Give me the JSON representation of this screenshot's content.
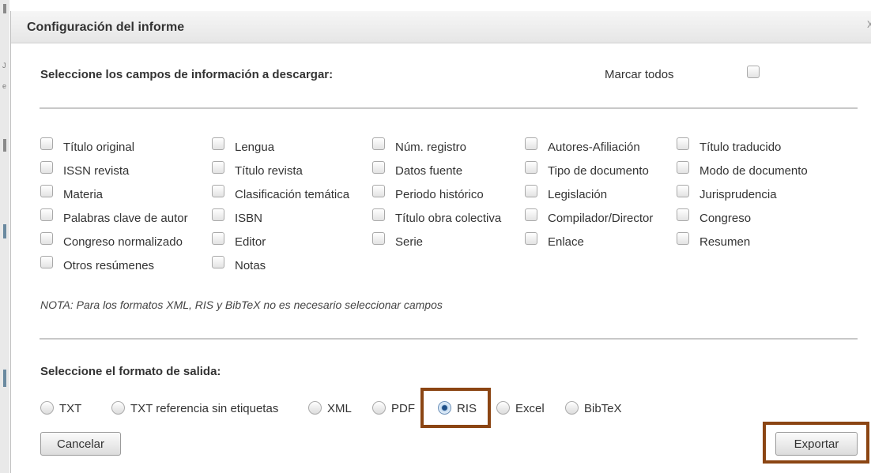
{
  "dialog": {
    "title": "Configuración del informe",
    "close_glyph": "x"
  },
  "fields_section": {
    "heading": "Seleccione los campos de información a descargar:",
    "mark_all_label": "Marcar todos",
    "columns": [
      [
        "Título original",
        "ISSN revista",
        "Materia",
        "Palabras clave de autor",
        "Congreso normalizado",
        "Otros resúmenes"
      ],
      [
        "Lengua",
        "Título revista",
        "Clasificación temática",
        "ISBN",
        "Editor",
        "Notas"
      ],
      [
        "Núm. registro",
        "Datos fuente",
        "Periodo histórico",
        "Título obra colectiva",
        "Serie"
      ],
      [
        "Autores-Afiliación",
        "Tipo de documento",
        "Legislación",
        "Compilador/Director",
        "Enlace"
      ],
      [
        "Título traducido",
        "Modo de documento",
        "Jurisprudencia",
        "Congreso",
        "Resumen"
      ]
    ],
    "note": "NOTA: Para los formatos XML, RIS y BibTeX no es necesario seleccionar campos"
  },
  "format_section": {
    "heading": "Seleccione el formato de salida:",
    "options": [
      "TXT",
      "TXT referencia sin etiquetas",
      "XML",
      "PDF",
      "RIS",
      "Excel",
      "BibTeX"
    ],
    "selected": "RIS"
  },
  "buttons": {
    "cancel": "Cancelar",
    "export": "Exportar"
  },
  "colors": {
    "highlight": "#8b4513",
    "divider": "#c8c8c8"
  }
}
